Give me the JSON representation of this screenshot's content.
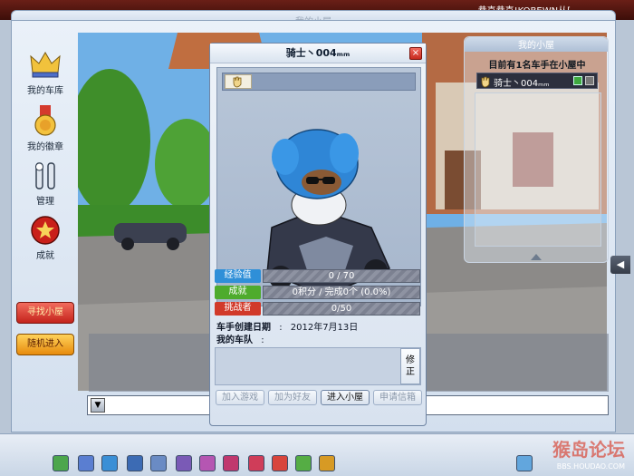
{
  "top": {
    "marquee": "恭喜恭喜!KOBEWN从[",
    "window_title": "我的小屋"
  },
  "sidebar": {
    "items": [
      {
        "label": "我的车库",
        "icon": "crown-icon"
      },
      {
        "label": "我的徽章",
        "icon": "medal-icon"
      },
      {
        "label": "管理",
        "icon": "tools-icon"
      },
      {
        "label": "成就",
        "icon": "achievement-icon"
      }
    ],
    "find_room": "寻找小屋",
    "random_enter": "随机进入"
  },
  "room": {
    "head": "我的小屋",
    "count_text": "目前有1名车手在小屋中",
    "member": "骑士丶004ₘₘ"
  },
  "dialog": {
    "title": "骑士丶004ₘₘ",
    "close": "×",
    "stats": [
      {
        "label": "经验值",
        "value": "0 / 70",
        "fill": 0.0,
        "color": "#2f8fd8"
      },
      {
        "label": "成就",
        "value": "0积分 / 完成0个  (0.0%)",
        "fill": 0.0,
        "color": "#4eab2d"
      },
      {
        "label": "挑战者",
        "value": "0/50",
        "fill": 0.0,
        "color": "#d13a2a"
      }
    ],
    "created_label": "车手创建日期",
    "created_sep": ":",
    "created_value": "2012年7月13日",
    "team_label": "我的车队",
    "team_sep": ":",
    "edit_label": "修\n正",
    "buttons": [
      {
        "label": "加入游戏",
        "active": false
      },
      {
        "label": "加为好友",
        "active": false
      },
      {
        "label": "进入小屋",
        "active": true
      },
      {
        "label": "申请信箱",
        "active": false
      }
    ]
  },
  "chat": {
    "dropdown": "▼"
  },
  "watermark": {
    "main": "猴岛论坛",
    "sub": "BBS.HOUDAO.COM"
  },
  "colors": {
    "frame": "#d3dfee",
    "accent_red": "#c4231b",
    "accent_orange": "#e78b0d"
  }
}
